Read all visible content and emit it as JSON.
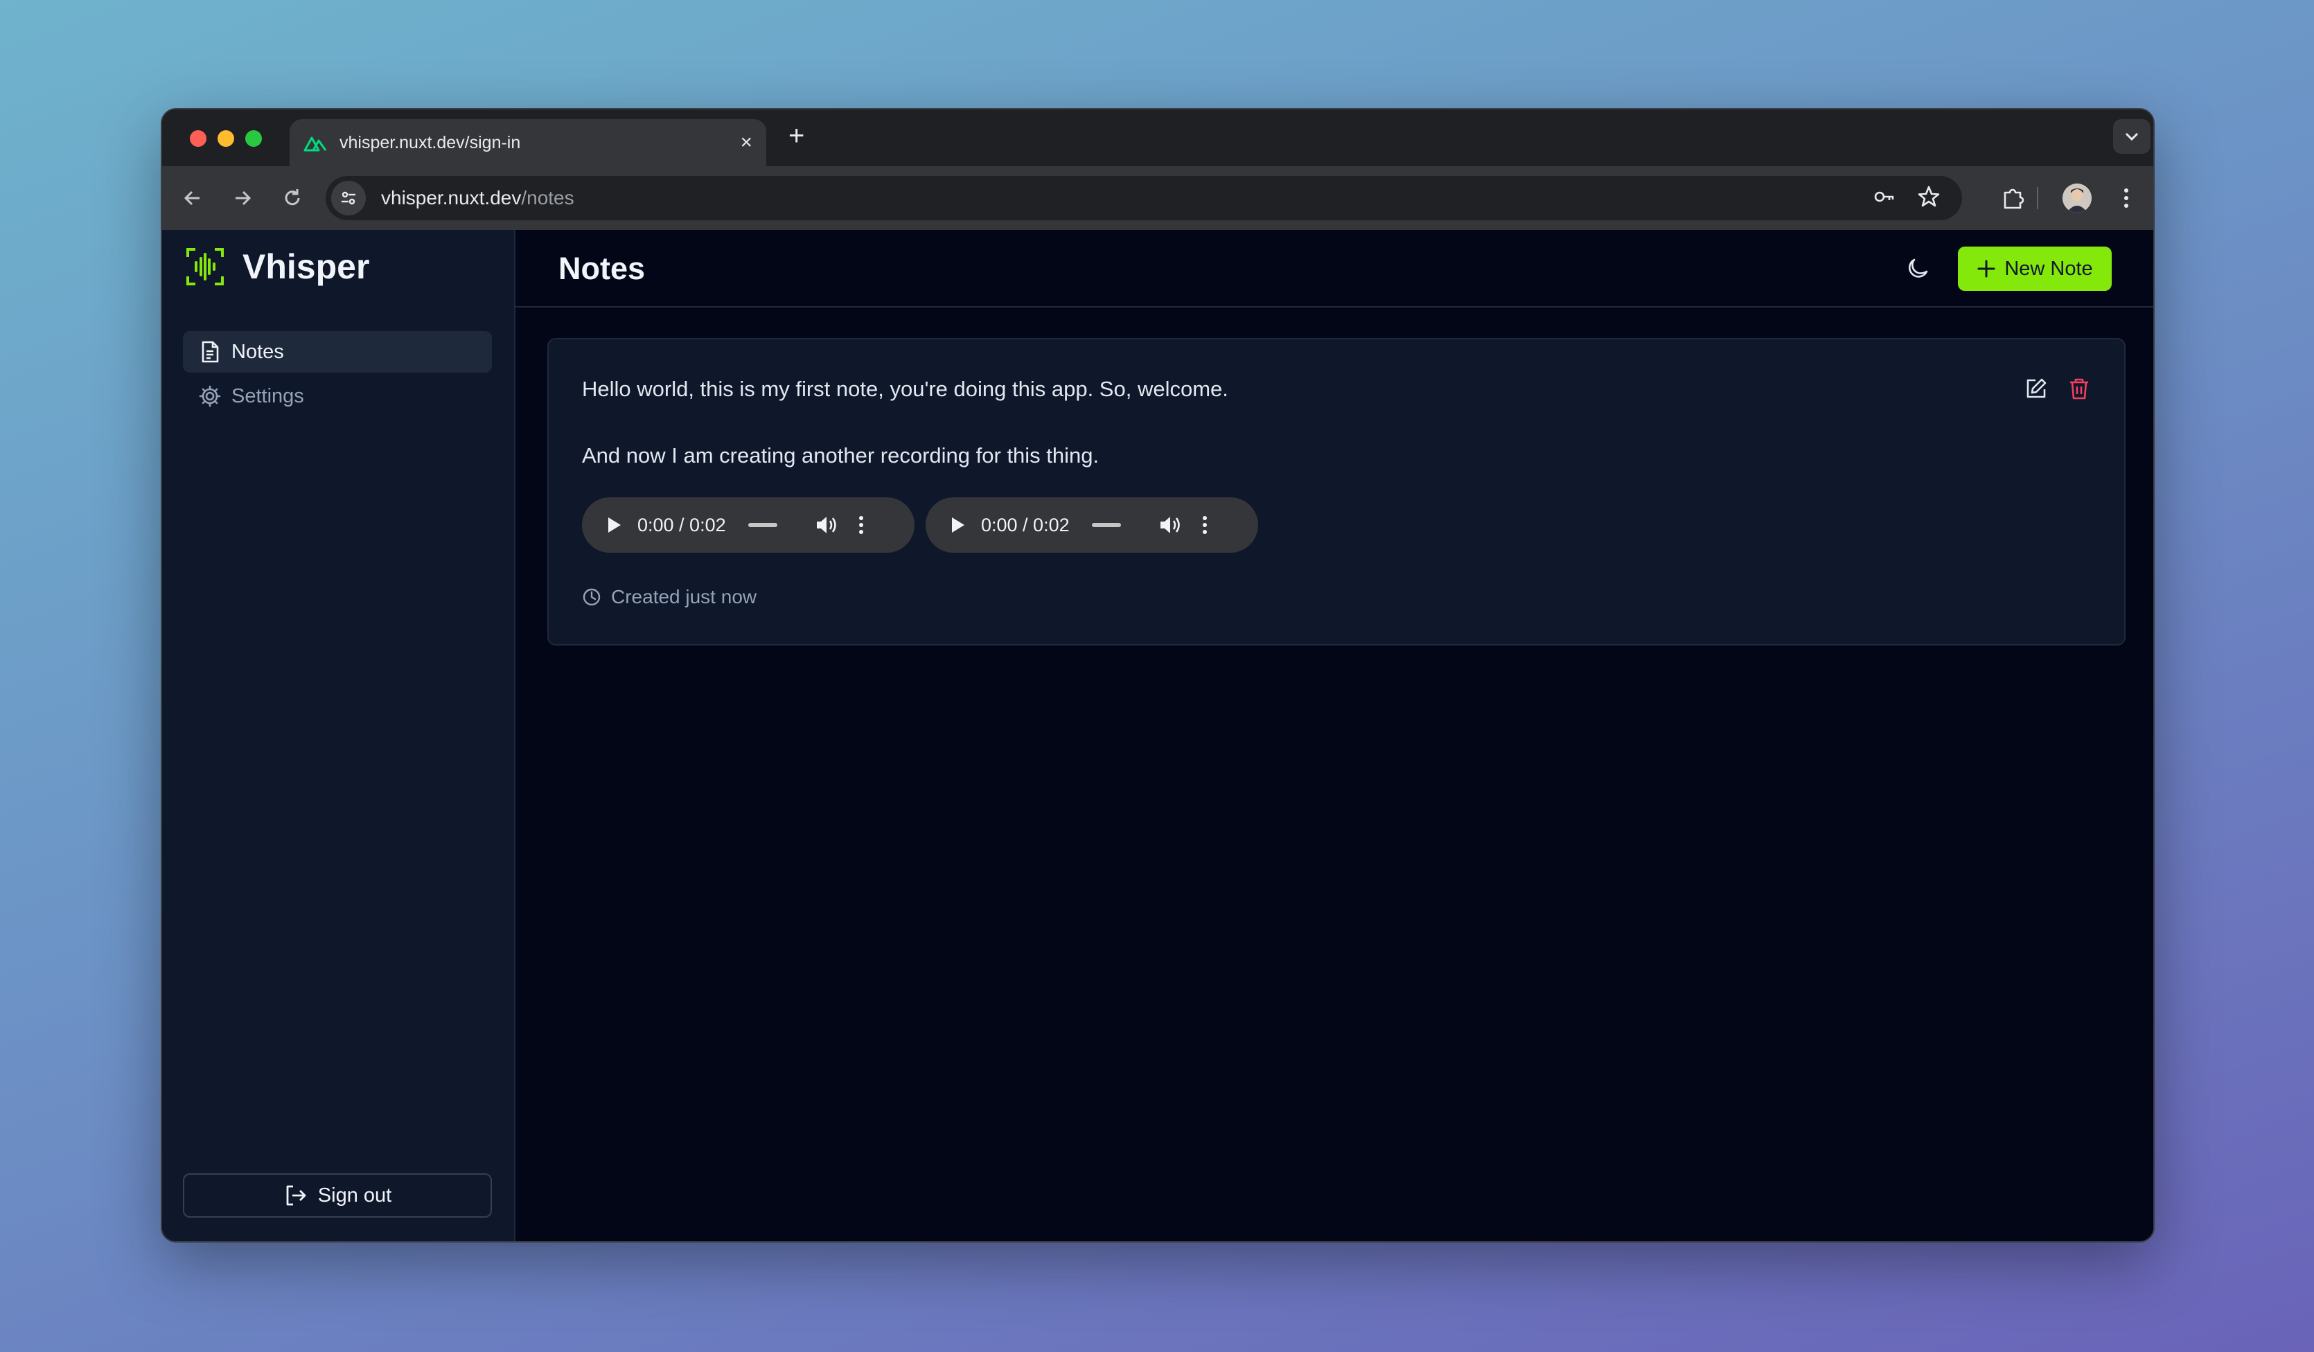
{
  "browser": {
    "tab": {
      "title": "vhisper.nuxt.dev/sign-in",
      "close_glyph": "×"
    },
    "new_tab_glyph": "+",
    "url": {
      "host": "vhisper.nuxt.dev",
      "path": "/notes"
    }
  },
  "sidebar": {
    "brand": "Vhisper",
    "items": [
      {
        "label": "Notes",
        "icon": "document-icon",
        "active": true
      },
      {
        "label": "Settings",
        "icon": "gear-icon",
        "active": false
      }
    ],
    "signout_label": "Sign out"
  },
  "header": {
    "title": "Notes",
    "new_note_label": "New Note"
  },
  "note": {
    "paragraphs": [
      "Hello world, this is my first note, you're doing this app. So, welcome.",
      "And now I am creating another recording for this thing."
    ],
    "recordings": [
      {
        "time": "0:00 / 0:02"
      },
      {
        "time": "0:00 / 0:02"
      }
    ],
    "created": "Created just now"
  },
  "colors": {
    "accent": "#84e80b",
    "danger": "#f43f5e",
    "sidebar_bg": "#0f172a",
    "main_bg": "#020617"
  }
}
